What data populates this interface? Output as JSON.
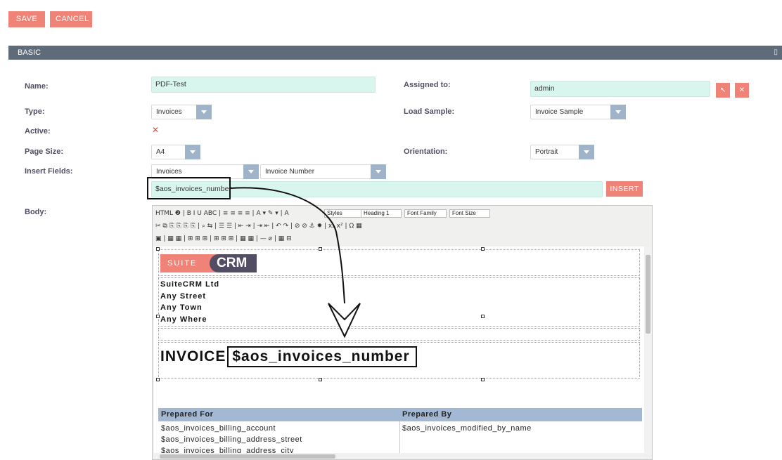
{
  "actions": {
    "save": "SAVE",
    "cancel": "CANCEL"
  },
  "panel": {
    "title": "BASIC",
    "collapse_icon": "▯"
  },
  "labels": {
    "name": "Name:",
    "assigned_to": "Assigned to:",
    "type": "Type:",
    "load_sample": "Load Sample:",
    "active": "Active:",
    "page_size": "Page Size:",
    "orientation": "Orientation:",
    "insert_fields": "Insert Fields:",
    "body": "Body:"
  },
  "fields": {
    "name": "PDF-Test",
    "assigned_to": "admin",
    "type": "Invoices",
    "load_sample": "Invoice Sample",
    "page_size": "A4",
    "orientation": "Portrait",
    "insert_module": "Invoices",
    "insert_field": "Invoice Number",
    "insert_value": "$aos_invoices_number",
    "insert_button": "INSERT",
    "active_icon": "✕"
  },
  "toolbar": {
    "styles": "Styles",
    "heading": "Heading 1",
    "font_family": "Font Family",
    "font_size": "Font Size",
    "row1_icons": "HTML  ❷ | B  I  U  ABC | ≡ ≡ ≡ ≡ | A ▾ ✎ ▾ | A",
    "row2_icons": "✂ ⧉ ⎘ ⎘ ⎘ ⎘ | ⌕ ⇆ | ☰ ☰ | ⇤ ⇥ | ⇥ ⇤ | ↶ ↷ | ⊘ ⊘ ⚓ ✹ | x₂ x² | Ω ▦",
    "row3_icons": "▣ | ▦ ▦ | ⊞ ⊞ ⊞ | ⊞ ⊞ ⊞ | ▦ ▦ | — ⌀ | ▦ ⊟"
  },
  "document": {
    "logo_suite": "SUITE",
    "logo_crm": "CRM",
    "address": [
      "SuiteCRM Ltd",
      "Any Street",
      "Any Town",
      "Any Where"
    ],
    "invoice_label": "INVOICE",
    "invoice_var": "$aos_invoices_number",
    "table": {
      "col1_header": "Prepared For",
      "col2_header": "Prepared By",
      "col1_rows": [
        "$aos_invoices_billing_account",
        "$aos_invoices_billing_address_street",
        "$aos_invoices_billing_address_city"
      ],
      "col2_rows": [
        "$aos_invoices_modified_by_name"
      ]
    }
  },
  "colors": {
    "accent": "#f08377",
    "header": "#5f6b78",
    "field_bg": "#d8f5ee",
    "table_head": "#a3b8d2"
  }
}
